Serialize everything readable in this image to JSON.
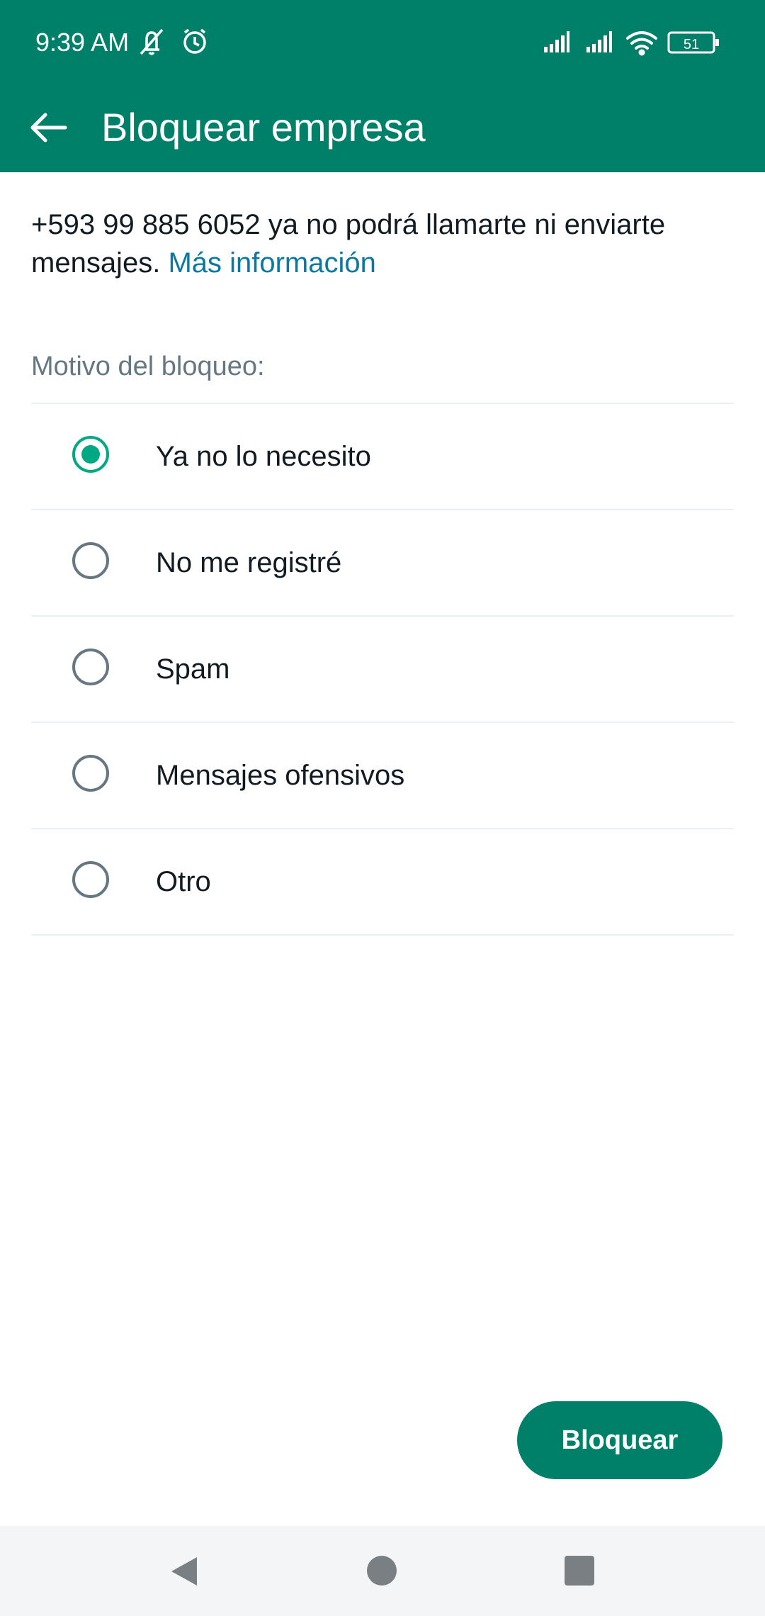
{
  "status_bar": {
    "time": "9:39 AM",
    "battery": "51",
    "icons": [
      "notifications-muted-icon",
      "alarm-icon",
      "signal-icon",
      "signal-icon",
      "wifi-icon",
      "battery-icon"
    ]
  },
  "app_bar": {
    "title": "Bloquear empresa",
    "back_icon": "arrow-left-icon"
  },
  "description": {
    "text": "+593 99 885 6052 ya no podrá llamarte ni enviarte mensajes.",
    "link": "Más información"
  },
  "reason": {
    "label": "Motivo del bloqueo:",
    "options": [
      {
        "label": "Ya no lo necesito",
        "selected": true
      },
      {
        "label": "No me registré",
        "selected": false
      },
      {
        "label": "Spam",
        "selected": false
      },
      {
        "label": "Mensajes ofensivos",
        "selected": false
      },
      {
        "label": "Otro",
        "selected": false
      }
    ]
  },
  "actions": {
    "block_label": "Bloquear"
  },
  "nav_bar": {
    "icons": [
      "nav-back-icon",
      "nav-home-icon",
      "nav-recents-icon"
    ]
  },
  "colors": {
    "brand": "#008069",
    "accent": "#00a884",
    "link": "#0b78a1",
    "muted": "#667781"
  }
}
